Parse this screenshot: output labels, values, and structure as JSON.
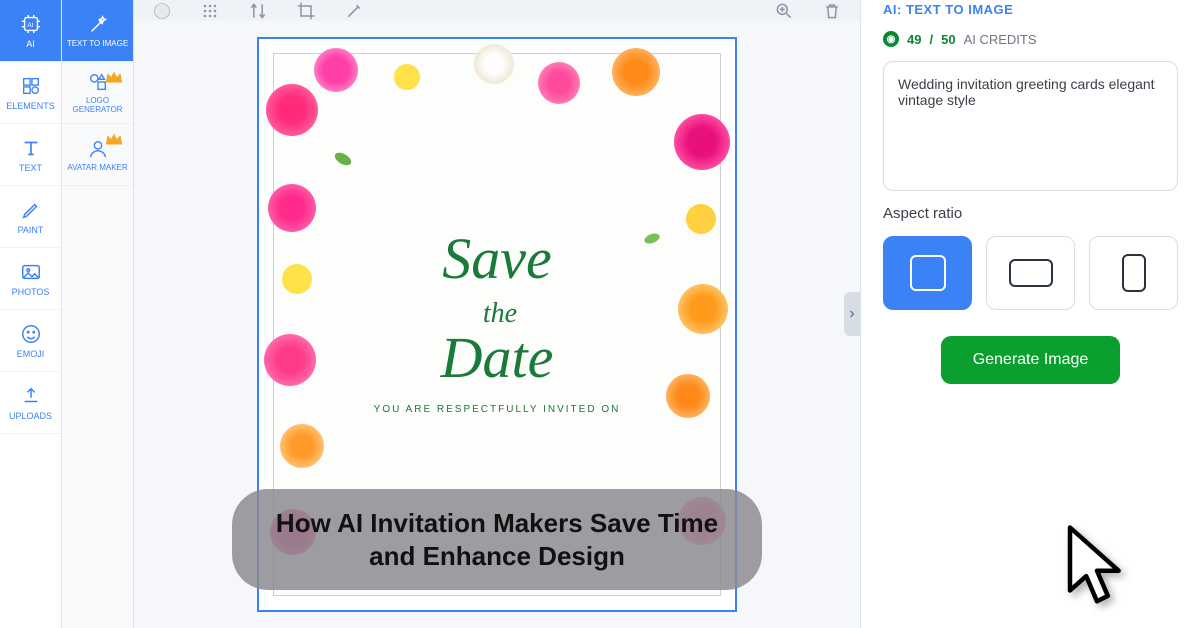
{
  "sidebar_main": {
    "items": [
      {
        "label": "AI",
        "icon": "ai"
      },
      {
        "label": "ELEMENTS",
        "icon": "elements"
      },
      {
        "label": "TEXT",
        "icon": "text"
      },
      {
        "label": "PAINT",
        "icon": "paint"
      },
      {
        "label": "PHOTOS",
        "icon": "photos"
      },
      {
        "label": "EMOJI",
        "icon": "emoji"
      },
      {
        "label": "UPLOADS",
        "icon": "uploads"
      }
    ]
  },
  "sidebar_sub": {
    "items": [
      {
        "label": "TEXT TO IMAGE",
        "icon": "sparkle"
      },
      {
        "label": "LOGO GENERATOR",
        "icon": "logo"
      },
      {
        "label": "AVATAR MAKER",
        "icon": "avatar"
      }
    ]
  },
  "canvas": {
    "card": {
      "line1": "Save",
      "line2_the": "the",
      "line2_main": "Date",
      "subline": "YOU ARE RESPECTFULLY INVITED ON"
    },
    "caption": "How AI Invitation Makers Save Time and Enhance Design"
  },
  "right_panel": {
    "title": "AI: TEXT TO IMAGE",
    "credits_used": "49",
    "credits_total": "50",
    "credits_sep": " / ",
    "credits_label": "AI CREDITS",
    "prompt": "Wedding invitation greeting cards elegant vintage style",
    "aspect_ratio_label": "Aspect ratio",
    "generate_label": "Generate Image"
  }
}
